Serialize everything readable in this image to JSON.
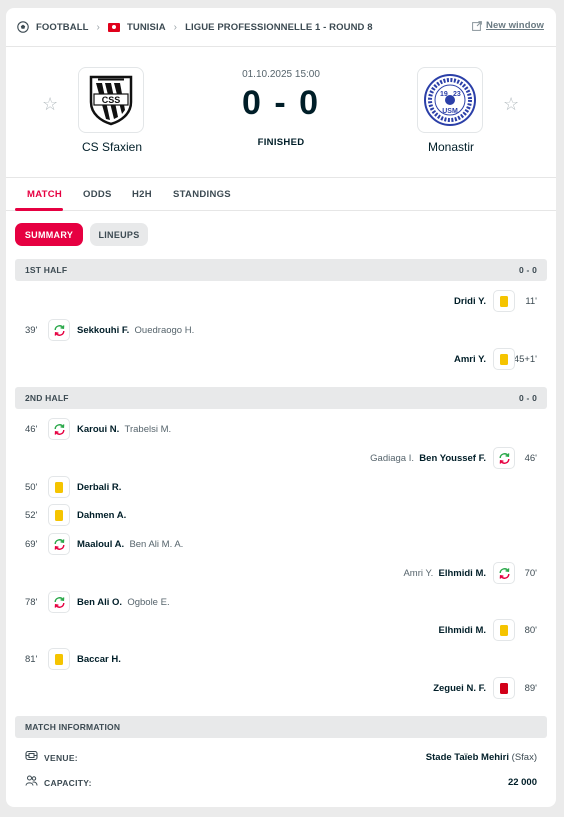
{
  "breadcrumb": {
    "sport": "FOOTBALL",
    "country": "TUNISIA",
    "competition": "LIGUE PROFESSIONNELLE 1 - ROUND 8",
    "new_window": "New window"
  },
  "match": {
    "date": "01.10.2025 15:00",
    "score": "0 - 0",
    "status": "FINISHED",
    "home": {
      "name": "CS Sfaxien",
      "logo_text": "CSS"
    },
    "away": {
      "name": "Monastir",
      "logo_text": "USM",
      "logo_year_left": "19",
      "logo_year_right": "23"
    }
  },
  "tabs": [
    "MATCH",
    "ODDS",
    "H2H",
    "STANDINGS"
  ],
  "subtabs": [
    "SUMMARY",
    "LINEUPS"
  ],
  "first_half": {
    "label": "1ST HALF",
    "score": "0 - 0",
    "incidents": [
      {
        "side": "away",
        "minute": "11'",
        "type": "yellow",
        "player": "Dridi Y.",
        "sub": ""
      },
      {
        "side": "home",
        "minute": "39'",
        "type": "substitution",
        "player": "Sekkouhi F.",
        "sub": "Ouedraogo H."
      },
      {
        "side": "away",
        "minute": "45+1'",
        "type": "yellow",
        "player": "Amri Y.",
        "sub": ""
      }
    ]
  },
  "second_half": {
    "label": "2ND HALF",
    "score": "0 - 0",
    "incidents": [
      {
        "side": "home",
        "minute": "46'",
        "type": "substitution",
        "player": "Karoui N.",
        "sub": "Trabelsi M."
      },
      {
        "side": "away",
        "minute": "46'",
        "type": "substitution",
        "player": "Ben Youssef F.",
        "sub": "Gadiaga I."
      },
      {
        "side": "home",
        "minute": "50'",
        "type": "yellow",
        "player": "Derbali R.",
        "sub": ""
      },
      {
        "side": "home",
        "minute": "52'",
        "type": "yellow",
        "player": "Dahmen A.",
        "sub": ""
      },
      {
        "side": "home",
        "minute": "69'",
        "type": "substitution",
        "player": "Maaloul A.",
        "sub": "Ben Ali M. A."
      },
      {
        "side": "away",
        "minute": "70'",
        "type": "substitution",
        "player": "Elhmidi M.",
        "sub": "Amri Y."
      },
      {
        "side": "home",
        "minute": "78'",
        "type": "substitution",
        "player": "Ben Ali O.",
        "sub": "Ogbole E."
      },
      {
        "side": "away",
        "minute": "80'",
        "type": "yellow",
        "player": "Elhmidi M.",
        "sub": ""
      },
      {
        "side": "home",
        "minute": "81'",
        "type": "yellow",
        "player": "Baccar H.",
        "sub": ""
      },
      {
        "side": "away",
        "minute": "89'",
        "type": "red",
        "player": "Zeguei N. F.",
        "sub": ""
      }
    ]
  },
  "match_info": {
    "label": "MATCH INFORMATION",
    "venue_label": "VENUE:",
    "venue": "Stade Taïeb Mehiri",
    "venue_city": "(Sfax)",
    "capacity_label": "CAPACITY:",
    "capacity": "22 000"
  },
  "colors": {
    "accent": "#e60041",
    "yellow_card": "#f5c400",
    "red_card": "#d20019",
    "sub_in": "#2aa84a",
    "sub_out": "#e60041"
  }
}
